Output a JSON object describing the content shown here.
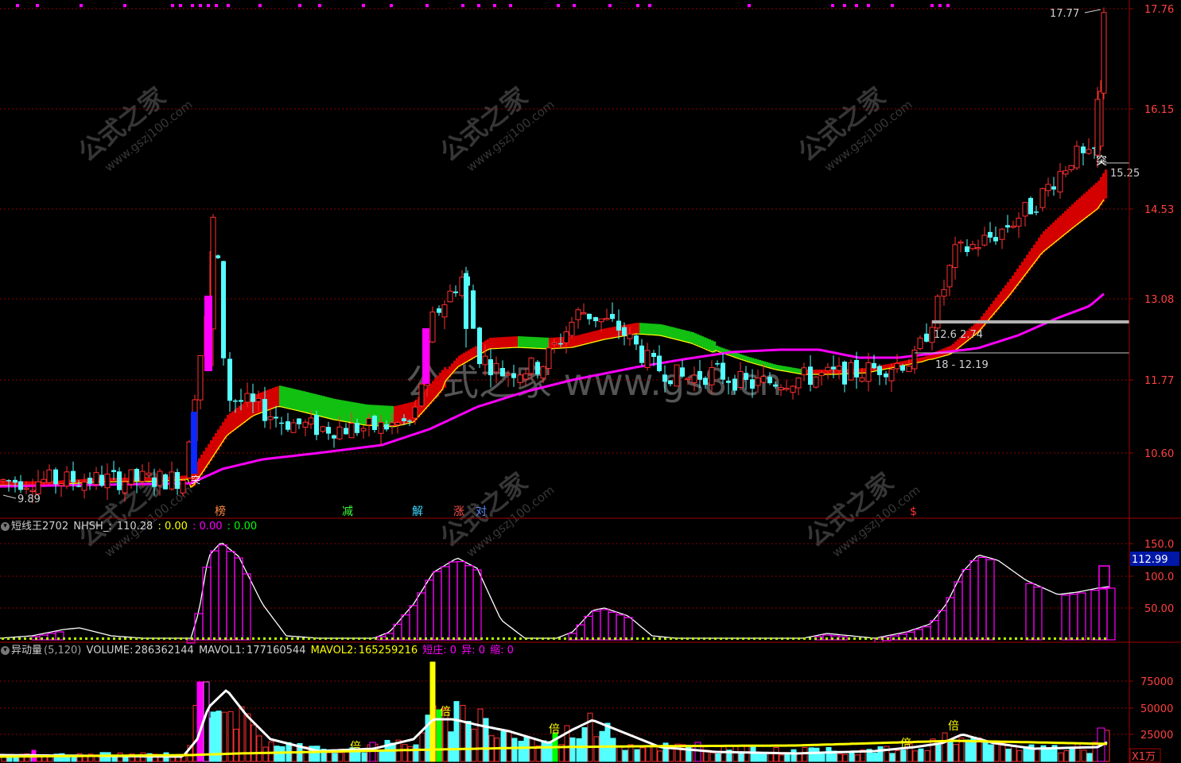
{
  "colors": {
    "background": "#000000",
    "grid": "#8a0000",
    "axis_line": "#a00000",
    "axis_text": "#ff4040",
    "up": "#ff3030",
    "down": "#54ffff",
    "ribbon_up": "#d40000",
    "ribbon_down": "#12c012",
    "long_ma": "#ff00ff",
    "ma_edge": "#ffff00",
    "curve": "#ffffff",
    "step": "#ff00ff",
    "dot": "#b8ff00",
    "volume_yellow": "#ffff00"
  },
  "watermarks": {
    "small": [
      "公式之家",
      "www.gszj100.com"
    ],
    "large": "公式之家 www.gs8.cn"
  },
  "price_panel": {
    "right_axis": [
      "17.76",
      "16.15",
      "14.53",
      "13.08",
      "11.77",
      "10.60"
    ],
    "high_label": "17.77",
    "low_label": "9.89",
    "tag_tu_right": "突",
    "tag_tu_left": "突",
    "label_1525": "15.25",
    "box_label_top": "12.6  2.74",
    "box_label_bottom": "18 - 12.19",
    "bottom_tags": [
      {
        "text": "榜",
        "color": "#ff8a3c"
      },
      {
        "text": "减",
        "color": "#3cff3c"
      },
      {
        "text": "解",
        "color": "#3cd8ff"
      },
      {
        "text": "涨",
        "color": "#ff5050"
      },
      {
        "text": "对",
        "color": "#5a8cff"
      },
      {
        "text": "$",
        "color": "#ff3030"
      }
    ]
  },
  "indicator_panel": {
    "title": "短线王2702",
    "field_name": "NHSH_:",
    "field_value": "110.28",
    "v1": ": 0.00",
    "v2": ": 0.00",
    "v3": ": 0.00",
    "right_axis": [
      "150.0",
      "100.0",
      "50.00"
    ],
    "current_value": "112.99"
  },
  "volume_panel": {
    "title": "异动量",
    "params": "(5,120)",
    "volume_label": "VOLUME:",
    "volume_value": "286362144",
    "mavol1_label": "MAVOL1:",
    "mavol1_value": "177160544",
    "mavol2_label": "MAVOL2:",
    "mavol2_value": "165259216",
    "short_zhuang": "短庄: 0",
    "yi": "异: 0",
    "suo": "缩: 0",
    "right_axis": [
      "75000",
      "50000",
      "25000"
    ],
    "unit": "X1万",
    "bei_tag": "倍"
  }
}
